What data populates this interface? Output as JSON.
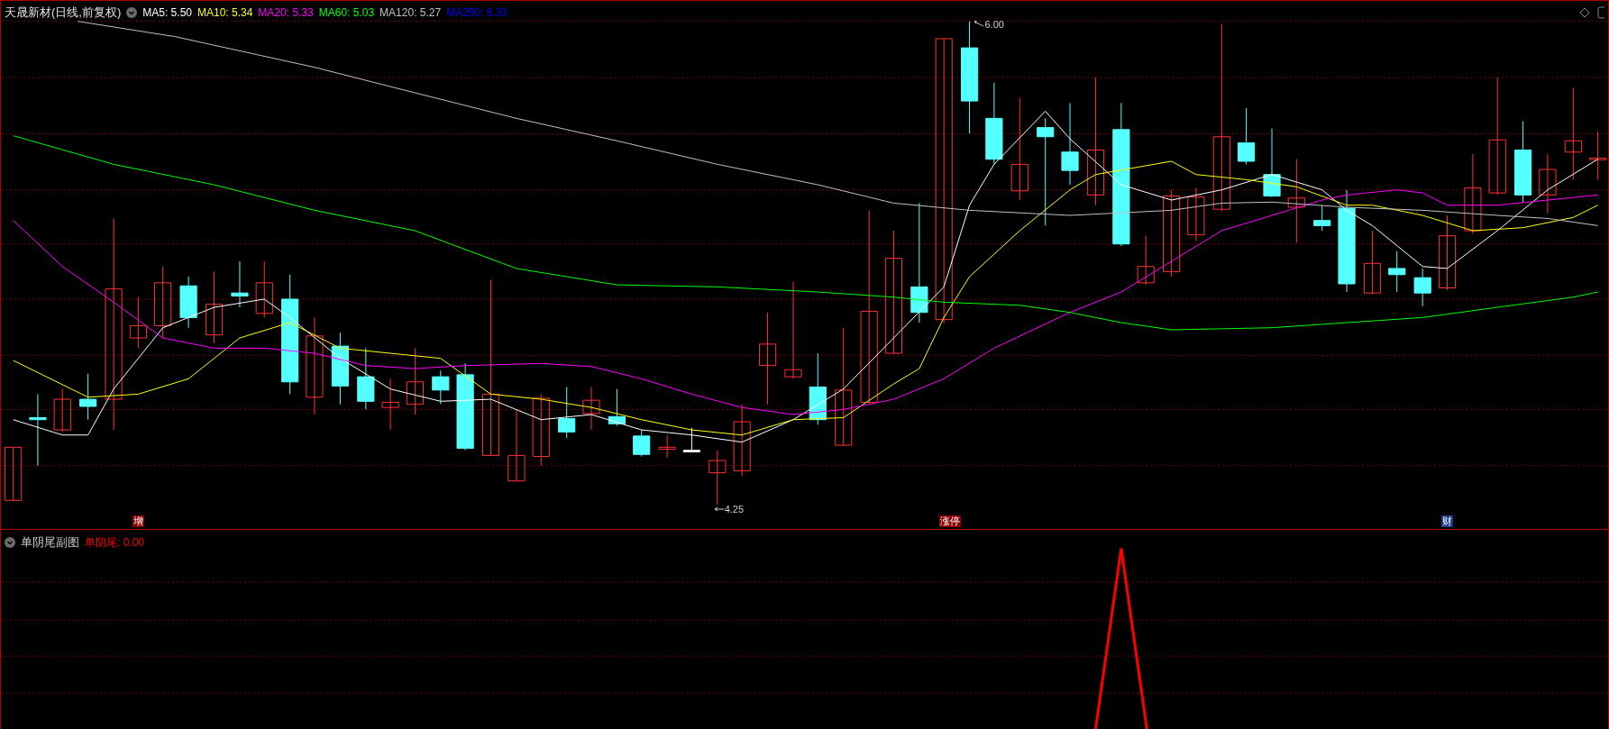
{
  "main_panel": {
    "title": "天晟新材(日线,前复权)",
    "moving_averages": [
      {
        "label": "MA5: 5.50",
        "color": "#ffffff"
      },
      {
        "label": "MA10: 5.34",
        "color": "#ffff00"
      },
      {
        "label": "MA20: 5.33",
        "color": "#ff00ff"
      },
      {
        "label": "MA60: 5.03",
        "color": "#00ff00"
      },
      {
        "label": "MA120: 5.27",
        "color": "#c0c0c0"
      },
      {
        "label": "MA250: 6.33",
        "color": "#0000ff"
      }
    ],
    "price_labels": [
      "6.00",
      "4.25"
    ],
    "event_markers": [
      {
        "label": "增",
        "color": "#8b0000"
      },
      {
        "label": "涨停",
        "color": "#8b0000"
      },
      {
        "label": "财",
        "color": "#1e3a8a"
      }
    ]
  },
  "sub_panel": {
    "title": "单阴尾副图",
    "indicator": {
      "label": "单阴尾: 0.00",
      "color": "#ff0000"
    }
  }
}
